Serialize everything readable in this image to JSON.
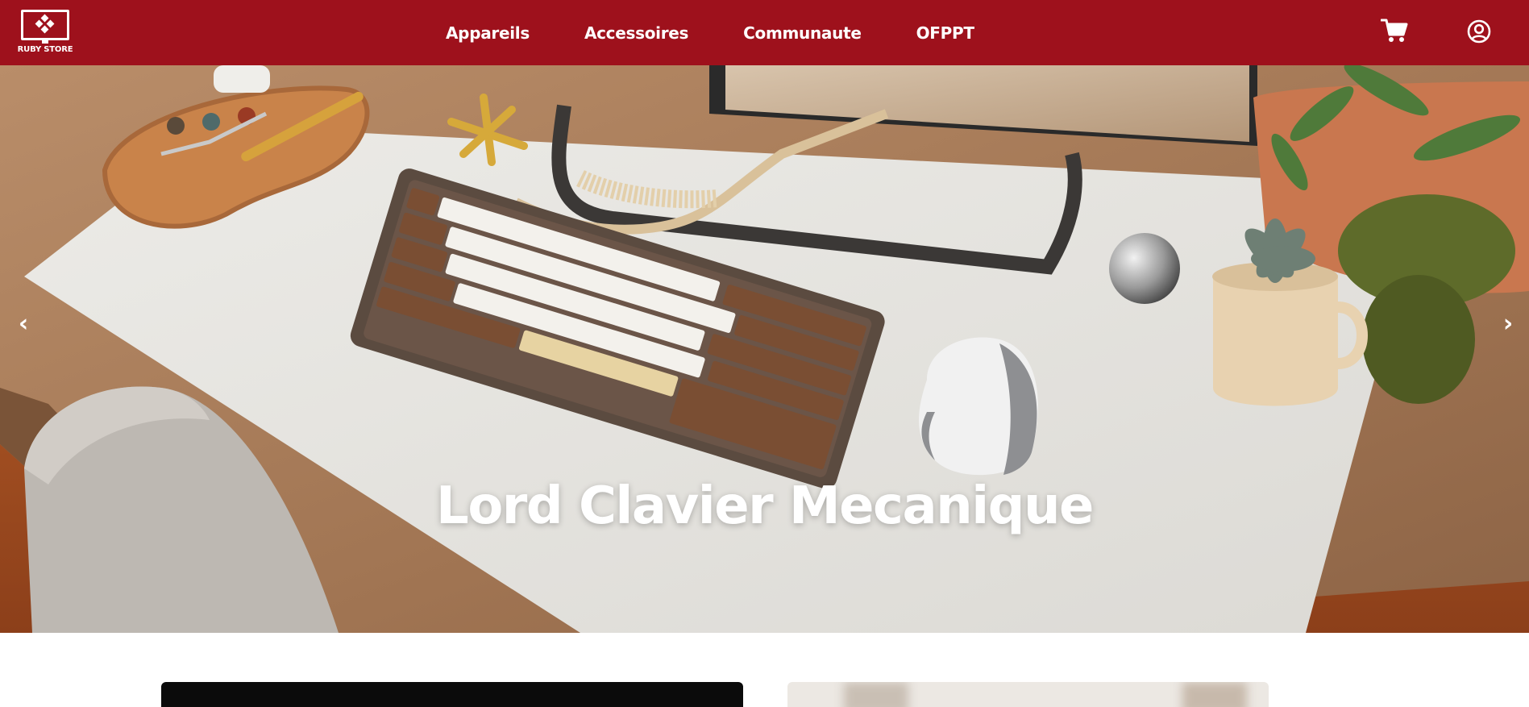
{
  "brand": {
    "name": "RUBY STORE",
    "logo_icon": "monitor-diamond-logo"
  },
  "nav": {
    "links": [
      {
        "label": "Appareils"
      },
      {
        "label": "Accessoires"
      },
      {
        "label": "Communaute"
      },
      {
        "label": "OFPPT"
      }
    ],
    "cart_icon": "cart-icon",
    "user_icon": "user-circle-icon"
  },
  "hero": {
    "title": "Lord Clavier Mecanique",
    "prev_arrow": "‹",
    "next_arrow": "›"
  },
  "colors": {
    "navbar": "#9e111c",
    "text": "#ffffff"
  }
}
